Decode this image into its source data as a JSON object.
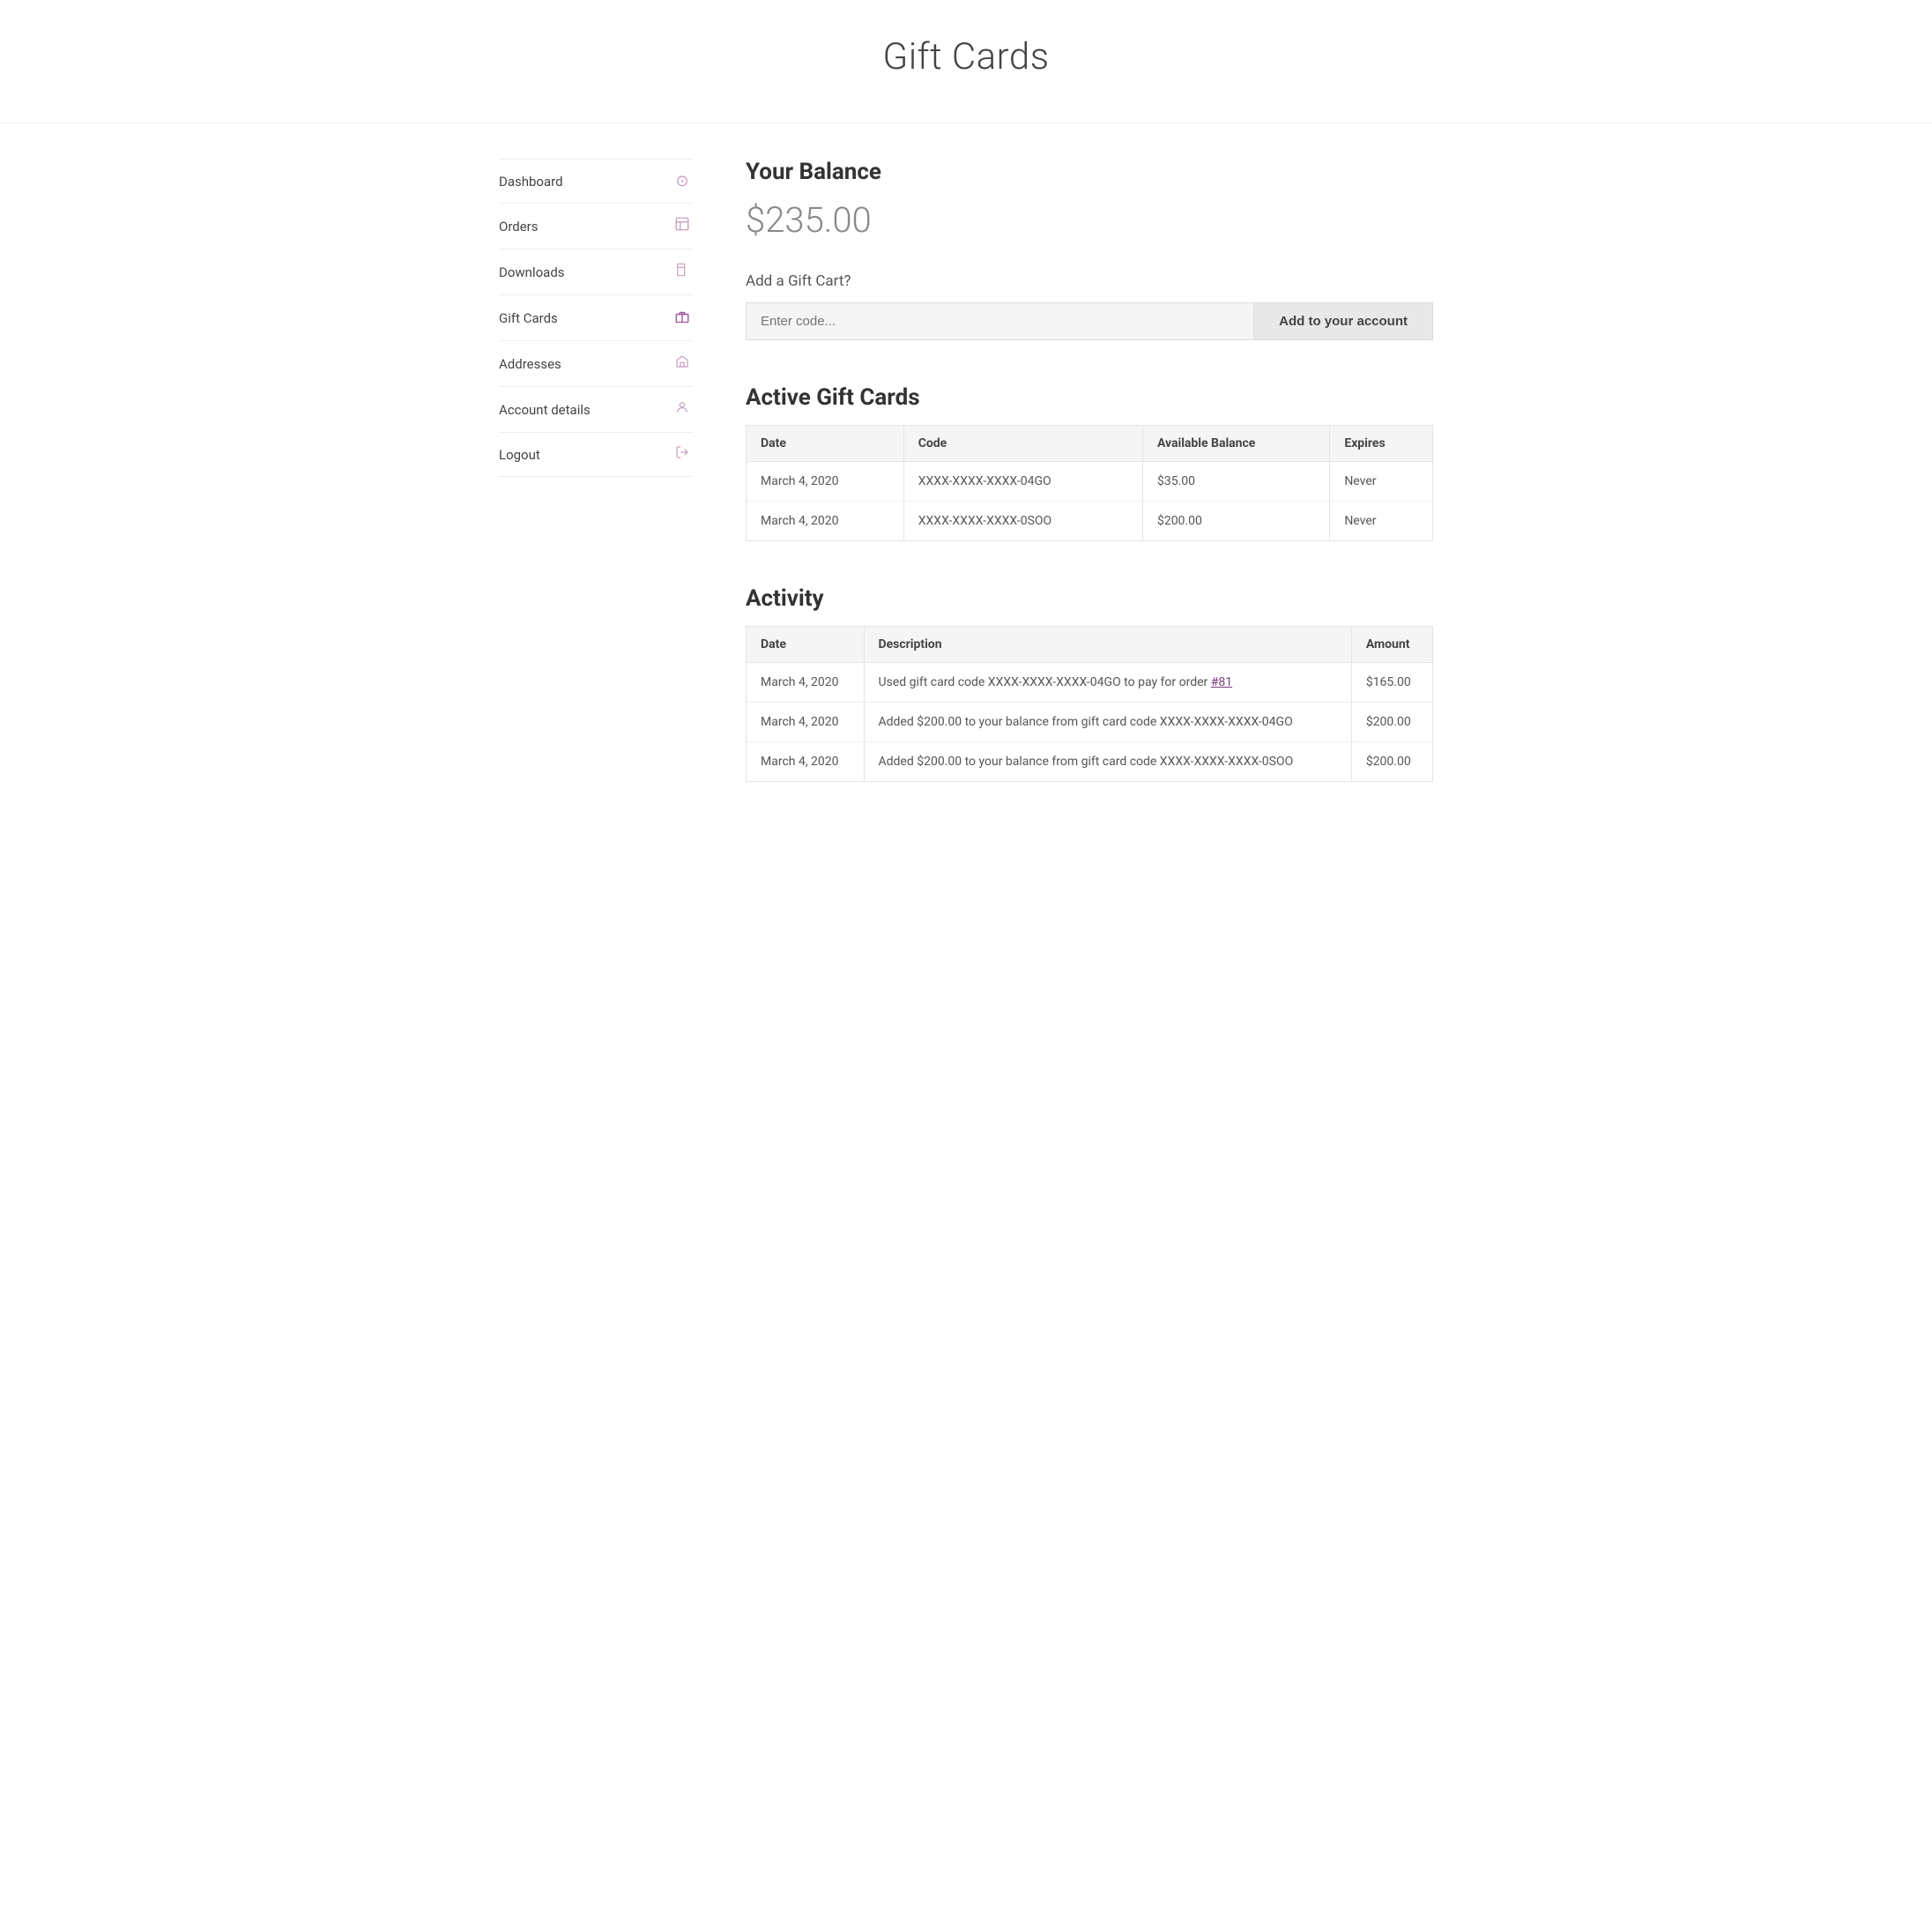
{
  "header": {
    "title": "Gift Cards"
  },
  "sidebar": {
    "items": [
      {
        "id": "dashboard",
        "label": "Dashboard",
        "icon": "⊙",
        "active": false
      },
      {
        "id": "orders",
        "label": "Orders",
        "icon": "🛒",
        "active": false
      },
      {
        "id": "downloads",
        "label": "Downloads",
        "icon": "📄",
        "active": false
      },
      {
        "id": "gift-cards",
        "label": "Gift Cards",
        "icon": "🎁",
        "active": true
      },
      {
        "id": "addresses",
        "label": "Addresses",
        "icon": "🏠",
        "active": false
      },
      {
        "id": "account-details",
        "label": "Account details",
        "icon": "👤",
        "active": false
      },
      {
        "id": "logout",
        "label": "Logout",
        "icon": "→",
        "active": false
      }
    ]
  },
  "main": {
    "balance_section": {
      "title": "Your Balance",
      "amount": "$235.00"
    },
    "add_gift_card": {
      "label": "Add a Gift Cart?",
      "placeholder": "Enter code...",
      "button_label": "Add to your account"
    },
    "active_gift_cards": {
      "title": "Active Gift Cards",
      "columns": [
        "Date",
        "Code",
        "Available Balance",
        "Expires"
      ],
      "rows": [
        {
          "date": "March 4, 2020",
          "code": "XXXX-XXXX-XXXX-04GO",
          "balance": "$35.00",
          "expires": "Never"
        },
        {
          "date": "March 4, 2020",
          "code": "XXXX-XXXX-XXXX-0SOO",
          "balance": "$200.00",
          "expires": "Never"
        }
      ]
    },
    "activity": {
      "title": "Activity",
      "columns": [
        "Date",
        "Description",
        "Amount"
      ],
      "rows": [
        {
          "date": "March 4, 2020",
          "description_prefix": "Used gift card code XXXX-XXXX-XXXX-04GO to pay for order ",
          "order_link_text": "#81",
          "order_link_href": "#81",
          "description_suffix": "",
          "amount": "$165.00"
        },
        {
          "date": "March 4, 2020",
          "description": "Added $200.00 to your balance from gift card code XXXX-XXXX-XXXX-04GO",
          "amount": "$200.00"
        },
        {
          "date": "March 4, 2020",
          "description": "Added $200.00 to your balance from gift card code XXXX-XXXX-XXXX-0SOO",
          "amount": "$200.00"
        }
      ]
    }
  }
}
